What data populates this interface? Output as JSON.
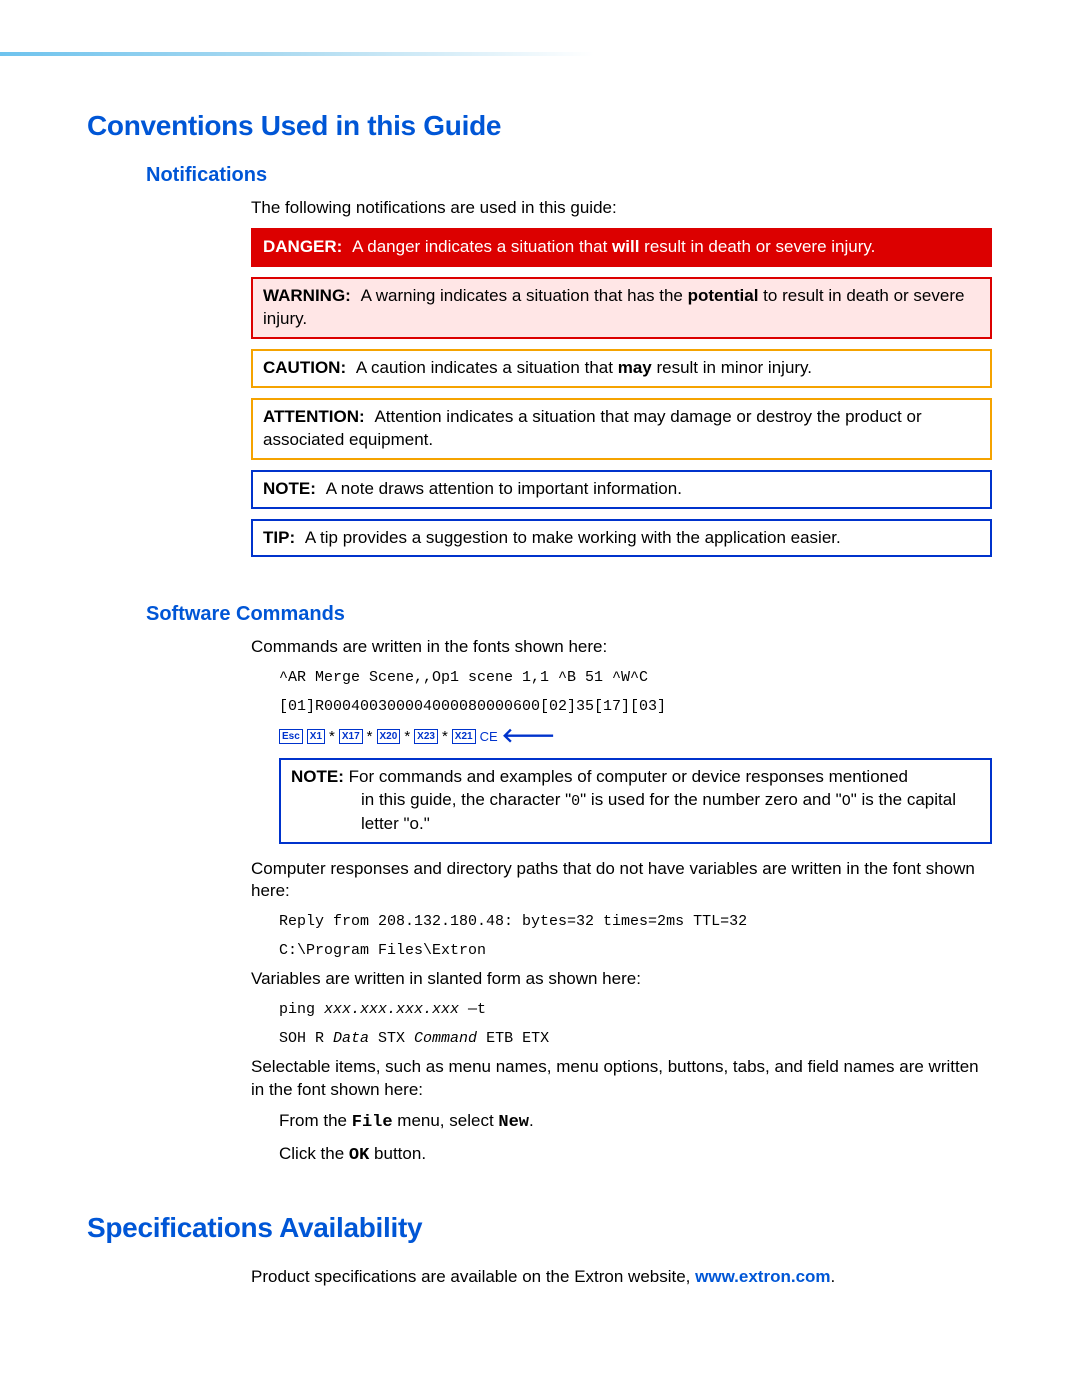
{
  "h1_conventions": "Conventions Used in this Guide",
  "h2_notifications": "Notifications",
  "p_notif_intro": "The following notifications are used in this guide:",
  "danger_label": "DANGER:",
  "danger_pre": "A danger indicates a situation that ",
  "danger_bold": "will",
  "danger_post": " result in death or severe injury.",
  "warning_label": "WARNING:",
  "warning_pre": "A warning indicates a situation that has the ",
  "warning_bold": "potential",
  "warning_post": " to result in death or severe injury.",
  "caution_label": "CAUTION:",
  "caution_pre": "A caution indicates a situation that ",
  "caution_bold": "may",
  "caution_post": " result in minor injury.",
  "attention_label": "ATTENTION:",
  "attention_text": "Attention indicates a situation that may damage or destroy the product or associated equipment.",
  "note_label": "NOTE:",
  "note_text": "A note draws attention to important information.",
  "tip_label": "TIP:",
  "tip_text": "A tip provides a suggestion to make working with the application easier.",
  "h2_software": "Software Commands",
  "p_cmd_intro": "Commands are written in the fonts shown here:",
  "cmd_line1": "^AR Merge Scene,,Op1 scene 1,1 ^B 51 ^W^C",
  "cmd_line2": "[01]R000400300004000080000600[02]35[17][03]",
  "key_esc": "Esc",
  "key_x1": "X1",
  "key_x17": "X17",
  "key_x20": "X20",
  "key_x23": "X23",
  "key_x21": "X21",
  "key_ce": "CE",
  "note2_label": "NOTE:",
  "note2_line1": "For commands and examples of computer or device responses mentioned",
  "note2_line2_pre": "in this guide, the character \"",
  "note2_zero": "0",
  "note2_line2_mid": "\" is used for the number zero and \"",
  "note2_oh": "O",
  "note2_line2_post": "\" is the capital letter \"o.\"",
  "p_responses": "Computer responses and directory paths that do not have variables are written in the font shown here:",
  "resp_line1": "Reply from 208.132.180.48: bytes=32 times=2ms TTL=32",
  "resp_line2": "C:\\Program Files\\Extron",
  "p_vars": "Variables are written in slanted form as shown here:",
  "var_line1_a": "ping ",
  "var_line1_b": "xxx.xxx.xxx.xxx",
  "var_line1_c": " —t",
  "var_line2_a": "SOH R ",
  "var_line2_b": "Data",
  "var_line2_c": " STX ",
  "var_line2_d": "Command",
  "var_line2_e": " ETB ETX",
  "p_select": "Selectable items, such as menu names, menu options, buttons, tabs, and field names are written in the font shown here:",
  "sel_pre1": "From the ",
  "sel_file": "File",
  "sel_mid1": " menu, select ",
  "sel_new": "New",
  "sel_post1": ".",
  "sel_pre2": "Click the ",
  "sel_ok": "OK",
  "sel_post2": " button.",
  "h1_specs": "Specifications Availability",
  "p_specs_pre": "Product specifications are available on the Extron website, ",
  "specs_link": "www.extron.com",
  "p_specs_post": "."
}
